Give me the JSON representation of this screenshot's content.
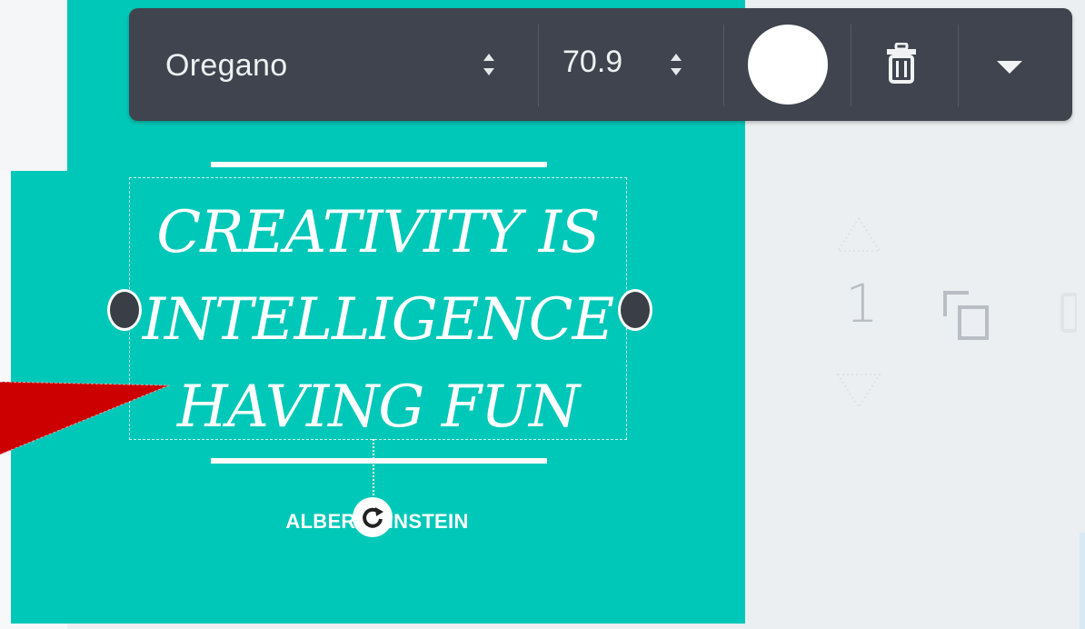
{
  "toolbar": {
    "font_name": "Oregano",
    "font_size": "70.9",
    "text_color": "#ffffff",
    "icons": [
      "font-stepper-icon",
      "size-stepper-icon",
      "trash-icon",
      "caret-down-icon"
    ]
  },
  "canvas": {
    "background_color": "#00c8b8",
    "quote_lines": [
      "CREATIVITY IS",
      "INTELLIGENCE",
      "HAVING FUN"
    ],
    "author": "ALBERT EINSTEIN"
  },
  "pages": {
    "current_page": "1",
    "icons": [
      "page-up-icon",
      "page-down-icon",
      "copy-page-icon",
      "delete-page-icon"
    ]
  },
  "annotation": {
    "arrow_color": "#cc0000"
  }
}
